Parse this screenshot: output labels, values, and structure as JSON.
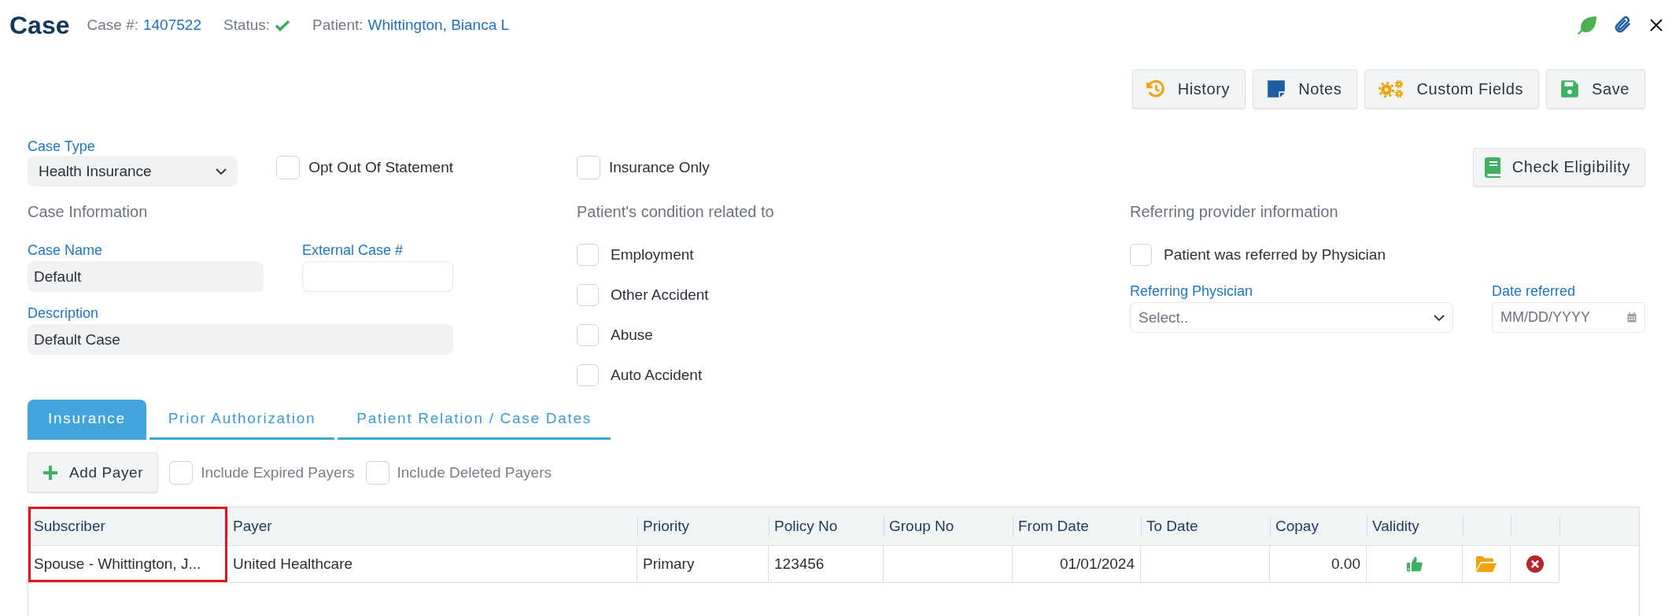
{
  "header": {
    "title": "Case",
    "case_number": {
      "label": "Case #:",
      "value": "1407522"
    },
    "status": {
      "label": "Status:",
      "active": true
    },
    "patient": {
      "label": "Patient:",
      "value": "Whittington, Bianca L"
    }
  },
  "actions": [
    {
      "label": "History"
    },
    {
      "label": "Notes"
    },
    {
      "label": "Custom Fields"
    },
    {
      "label": "Save"
    }
  ],
  "case_type": {
    "label": "Case Type",
    "value": "Health Insurance"
  },
  "options": [
    {
      "label": "Opt Out Of Statement",
      "checked": false
    },
    {
      "label": "Insurance Only",
      "checked": false
    }
  ],
  "check_eligibility": {
    "label": "Check Eligibility"
  },
  "case_information": {
    "heading": "Case Information",
    "case_name": {
      "label": "Case Name",
      "value": "Default"
    },
    "external_case": {
      "label": "External Case #"
    },
    "description": {
      "label": "Description",
      "value": "Default Case"
    }
  },
  "condition": {
    "heading": "Patient's condition related to",
    "items": [
      {
        "label": "Employment",
        "checked": false
      },
      {
        "label": "Other Accident",
        "checked": false
      },
      {
        "label": "Abuse",
        "checked": false
      },
      {
        "label": "Auto Accident",
        "checked": false
      }
    ]
  },
  "referring": {
    "heading": "Referring provider information",
    "referred": {
      "label": "Patient was referred by Physician",
      "checked": false
    },
    "physician": {
      "label": "Referring Physician",
      "placeholder": "Select.."
    },
    "date": {
      "label": "Date referred",
      "placeholder": "MM/DD/YYYY"
    }
  },
  "tabs": [
    {
      "label": "Insurance",
      "selected": true
    },
    {
      "label": "Prior Authorization",
      "selected": false
    },
    {
      "label": "Patient Relation / Case Dates",
      "selected": false
    }
  ],
  "payer_toolbar": {
    "add_label": "Add Payer",
    "filters": [
      {
        "label": "Include Expired Payers",
        "checked": false
      },
      {
        "label": "Include Deleted Payers",
        "checked": false
      }
    ]
  },
  "table": {
    "columns": [
      {
        "label": "Subscriber",
        "highlighted": true
      },
      {
        "label": "Payer",
        "highlighted": false
      },
      {
        "label": "Priority",
        "highlighted": false
      },
      {
        "label": "Policy No",
        "highlighted": false
      },
      {
        "label": "Group No",
        "highlighted": false
      },
      {
        "label": "From Date",
        "highlighted": false
      },
      {
        "label": "To Date",
        "highlighted": false
      },
      {
        "label": "Copay",
        "highlighted": false
      },
      {
        "label": "Validity",
        "highlighted": false
      }
    ],
    "rows": [
      {
        "subscriber": "Spouse - Whittington, J...",
        "payer": "United Healthcare",
        "priority": "Primary",
        "policy_no": "123456",
        "from_date": "01/01/2024",
        "copay": "0.00",
        "valid": true
      }
    ]
  }
}
